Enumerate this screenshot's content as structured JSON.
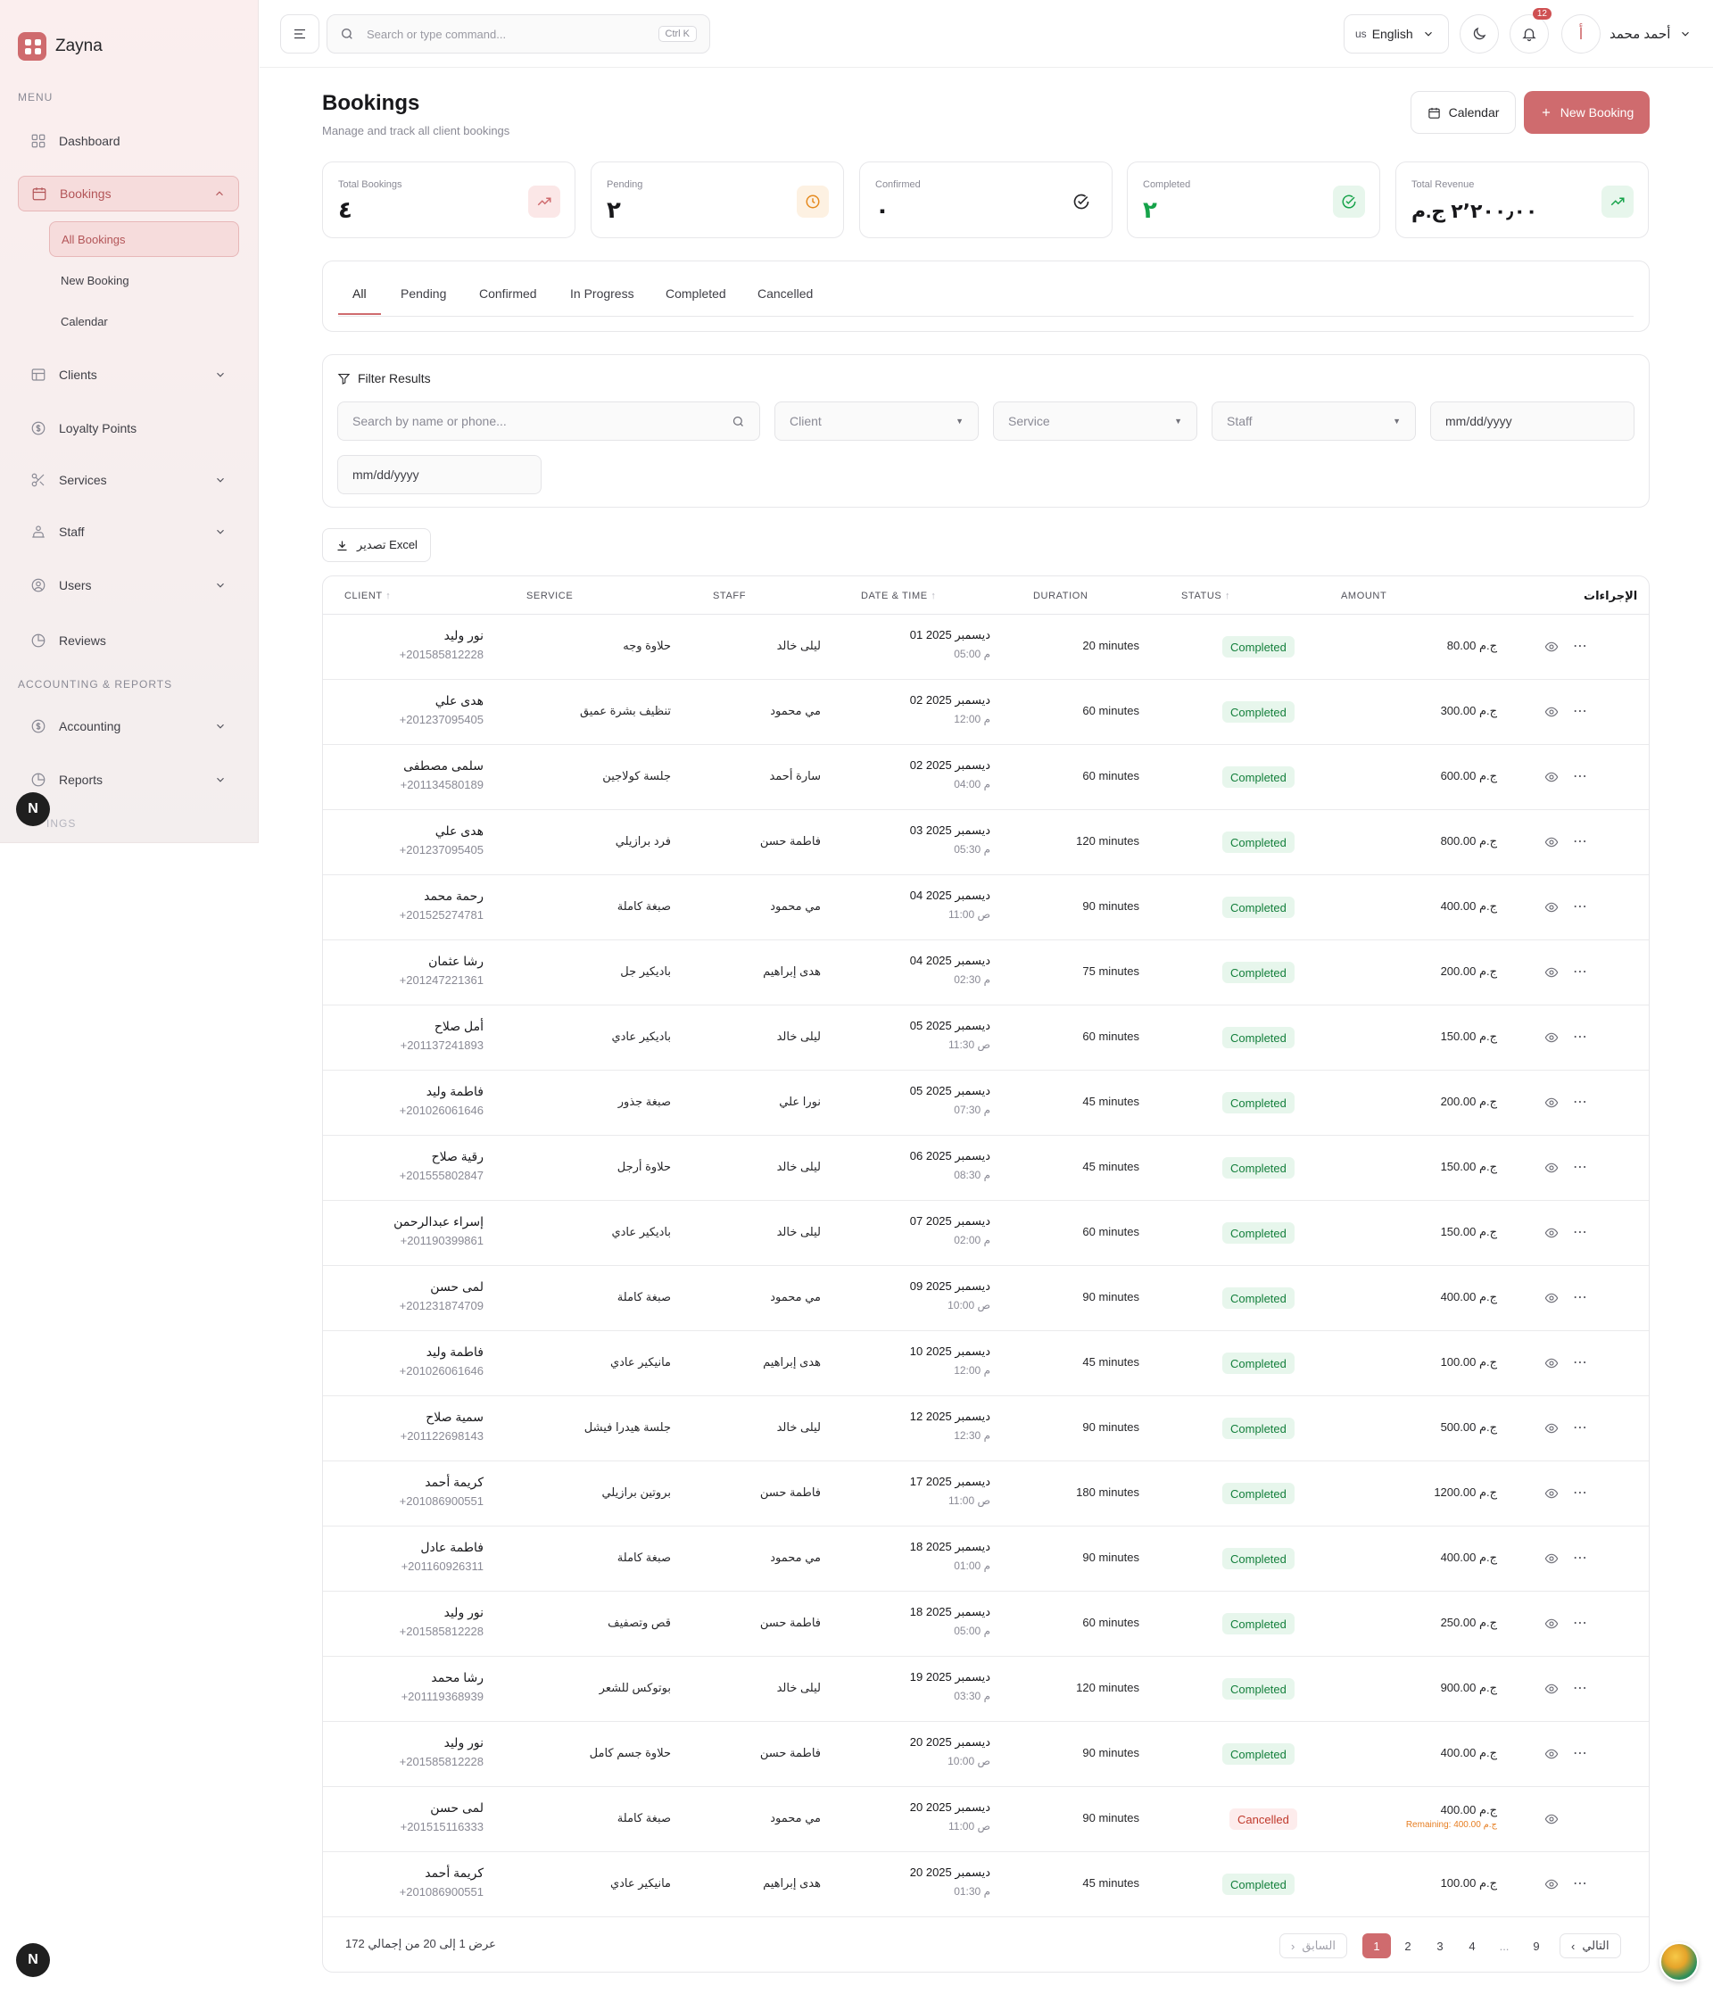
{
  "brand": {
    "name": "Zayna"
  },
  "sidebar": {
    "menu_label": "MENU",
    "items": [
      {
        "label": "Dashboard"
      },
      {
        "label": "Bookings"
      },
      {
        "label": "Clients"
      },
      {
        "label": "Loyalty Points"
      },
      {
        "label": "Services"
      },
      {
        "label": "Staff"
      },
      {
        "label": "Users"
      },
      {
        "label": "Reviews"
      },
      {
        "label": "Accounting"
      },
      {
        "label": "Reports"
      }
    ],
    "bookings_sub": [
      {
        "label": "All Bookings"
      },
      {
        "label": "New Booking"
      },
      {
        "label": "Calendar"
      }
    ],
    "accounting_label": "ACCOUNTING & REPORTS",
    "settings_label": "INGS",
    "n_badge": "N"
  },
  "header": {
    "search_placeholder": "Search or type command...",
    "shortcut": "Ctrl K",
    "lang_code": "us",
    "lang_label": "English",
    "notif_count": "12",
    "avatar_initial": "أ",
    "user_name": "أحمد محمد"
  },
  "page": {
    "title": "Bookings",
    "subtitle": "Manage and track all client bookings",
    "calendar_btn": "Calendar",
    "new_booking_btn": "New Booking"
  },
  "stats": [
    {
      "label": "Total Bookings",
      "value": "٤"
    },
    {
      "label": "Pending",
      "value": "٢"
    },
    {
      "label": "Confirmed",
      "value": "٠"
    },
    {
      "label": "Completed",
      "value": "٢"
    },
    {
      "label": "Total Revenue",
      "value": "٢٬٢٠٠٫٠٠ ج.م"
    }
  ],
  "tabs": [
    "All",
    "Pending",
    "Confirmed",
    "In Progress",
    "Completed",
    "Cancelled"
  ],
  "filters": {
    "title": "Filter Results",
    "search_placeholder": "Search by name or phone...",
    "client": "Client",
    "service": "Service",
    "staff": "Staff",
    "date_from": "mm/dd/yyyy",
    "date_to": "mm/dd/yyyy"
  },
  "export_label": "تصدير Excel",
  "table": {
    "columns": [
      "CLIENT",
      "SERVICE",
      "STAFF",
      "DATE & TIME",
      "DURATION",
      "STATUS",
      "AMOUNT",
      "الإجراءات"
    ],
    "rows": [
      {
        "name": "نور وليد",
        "phone": "+201585812228",
        "service": "حلاوة وجه",
        "staff": "ليلى خالد",
        "date": "01 ديسمبر 2025",
        "time": "05:00 م",
        "duration": "20 minutes",
        "status": "Completed",
        "amount": "80.00 ج.م",
        "remaining": ""
      },
      {
        "name": "هدى علي",
        "phone": "+201237095405",
        "service": "تنظيف بشرة عميق",
        "staff": "مي محمود",
        "date": "02 ديسمبر 2025",
        "time": "12:00 م",
        "duration": "60 minutes",
        "status": "Completed",
        "amount": "300.00 ج.م",
        "remaining": ""
      },
      {
        "name": "سلمى مصطفى",
        "phone": "+201134580189",
        "service": "جلسة كولاجين",
        "staff": "سارة أحمد",
        "date": "02 ديسمبر 2025",
        "time": "04:00 م",
        "duration": "60 minutes",
        "status": "Completed",
        "amount": "600.00 ج.م",
        "remaining": ""
      },
      {
        "name": "هدى علي",
        "phone": "+201237095405",
        "service": "فرد برازيلي",
        "staff": "فاطمة حسن",
        "date": "03 ديسمبر 2025",
        "time": "05:30 م",
        "duration": "120 minutes",
        "status": "Completed",
        "amount": "800.00 ج.م",
        "remaining": ""
      },
      {
        "name": "رحمة محمد",
        "phone": "+201525274781",
        "service": "صبغة كاملة",
        "staff": "مي محمود",
        "date": "04 ديسمبر 2025",
        "time": "11:00 ص",
        "duration": "90 minutes",
        "status": "Completed",
        "amount": "400.00 ج.م",
        "remaining": ""
      },
      {
        "name": "رشا عثمان",
        "phone": "+201247221361",
        "service": "باديكير جل",
        "staff": "هدى إبراهيم",
        "date": "04 ديسمبر 2025",
        "time": "02:30 م",
        "duration": "75 minutes",
        "status": "Completed",
        "amount": "200.00 ج.م",
        "remaining": ""
      },
      {
        "name": "أمل صلاح",
        "phone": "+201137241893",
        "service": "باديكير عادي",
        "staff": "ليلى خالد",
        "date": "05 ديسمبر 2025",
        "time": "11:30 ص",
        "duration": "60 minutes",
        "status": "Completed",
        "amount": "150.00 ج.م",
        "remaining": ""
      },
      {
        "name": "فاطمة وليد",
        "phone": "+201026061646",
        "service": "صبغة جذور",
        "staff": "نورا علي",
        "date": "05 ديسمبر 2025",
        "time": "07:30 م",
        "duration": "45 minutes",
        "status": "Completed",
        "amount": "200.00 ج.م",
        "remaining": ""
      },
      {
        "name": "رقية صلاح",
        "phone": "+201555802847",
        "service": "حلاوة أرجل",
        "staff": "ليلى خالد",
        "date": "06 ديسمبر 2025",
        "time": "08:30 م",
        "duration": "45 minutes",
        "status": "Completed",
        "amount": "150.00 ج.م",
        "remaining": ""
      },
      {
        "name": "إسراء عبدالرحمن",
        "phone": "+201190399861",
        "service": "باديكير عادي",
        "staff": "ليلى خالد",
        "date": "07 ديسمبر 2025",
        "time": "02:00 م",
        "duration": "60 minutes",
        "status": "Completed",
        "amount": "150.00 ج.م",
        "remaining": ""
      },
      {
        "name": "لمى حسن",
        "phone": "+201231874709",
        "service": "صبغة كاملة",
        "staff": "مي محمود",
        "date": "09 ديسمبر 2025",
        "time": "10:00 ص",
        "duration": "90 minutes",
        "status": "Completed",
        "amount": "400.00 ج.م",
        "remaining": ""
      },
      {
        "name": "فاطمة وليد",
        "phone": "+201026061646",
        "service": "مانيكير عادي",
        "staff": "هدى إبراهيم",
        "date": "10 ديسمبر 2025",
        "time": "12:00 م",
        "duration": "45 minutes",
        "status": "Completed",
        "amount": "100.00 ج.م",
        "remaining": ""
      },
      {
        "name": "سمية صلاح",
        "phone": "+201122698143",
        "service": "جلسة هيدرا فيشل",
        "staff": "ليلى خالد",
        "date": "12 ديسمبر 2025",
        "time": "12:30 م",
        "duration": "90 minutes",
        "status": "Completed",
        "amount": "500.00 ج.م",
        "remaining": ""
      },
      {
        "name": "كريمة أحمد",
        "phone": "+201086900551",
        "service": "بروتين برازيلي",
        "staff": "فاطمة حسن",
        "date": "17 ديسمبر 2025",
        "time": "11:00 ص",
        "duration": "180 minutes",
        "status": "Completed",
        "amount": "1200.00 ج.م",
        "remaining": ""
      },
      {
        "name": "فاطمة عادل",
        "phone": "+201160926311",
        "service": "صبغة كاملة",
        "staff": "مي محمود",
        "date": "18 ديسمبر 2025",
        "time": "01:00 م",
        "duration": "90 minutes",
        "status": "Completed",
        "amount": "400.00 ج.م",
        "remaining": ""
      },
      {
        "name": "نور وليد",
        "phone": "+201585812228",
        "service": "قص وتصفيف",
        "staff": "فاطمة حسن",
        "date": "18 ديسمبر 2025",
        "time": "05:00 م",
        "duration": "60 minutes",
        "status": "Completed",
        "amount": "250.00 ج.م",
        "remaining": ""
      },
      {
        "name": "رشا محمد",
        "phone": "+201119368939",
        "service": "بوتوكس للشعر",
        "staff": "ليلى خالد",
        "date": "19 ديسمبر 2025",
        "time": "03:30 م",
        "duration": "120 minutes",
        "status": "Completed",
        "amount": "900.00 ج.م",
        "remaining": ""
      },
      {
        "name": "نور وليد",
        "phone": "+201585812228",
        "service": "حلاوة جسم كامل",
        "staff": "فاطمة حسن",
        "date": "20 ديسمبر 2025",
        "time": "10:00 ص",
        "duration": "90 minutes",
        "status": "Completed",
        "amount": "400.00 ج.م",
        "remaining": ""
      },
      {
        "name": "لمى حسن",
        "phone": "+201515116333",
        "service": "صبغة كاملة",
        "staff": "مي محمود",
        "date": "20 ديسمبر 2025",
        "time": "11:00 ص",
        "duration": "90 minutes",
        "status": "Cancelled",
        "amount": "400.00 ج.م",
        "remaining": "Remaining: 400.00 ج.م"
      },
      {
        "name": "كريمة أحمد",
        "phone": "+201086900551",
        "service": "مانيكير عادي",
        "staff": "هدى إبراهيم",
        "date": "20 ديسمبر 2025",
        "time": "01:30 م",
        "duration": "45 minutes",
        "status": "Completed",
        "amount": "100.00 ج.م",
        "remaining": ""
      }
    ]
  },
  "pagination": {
    "info": "عرض 1 إلى 20 من إجمالي 172",
    "prev": "السابق",
    "pages": [
      "1",
      "2",
      "3",
      "4",
      "...",
      "9"
    ],
    "current": "1",
    "next": "التالي"
  },
  "colors": {
    "accent": "#cf6b6e",
    "success": "#15803d",
    "danger": "#c0392b"
  }
}
